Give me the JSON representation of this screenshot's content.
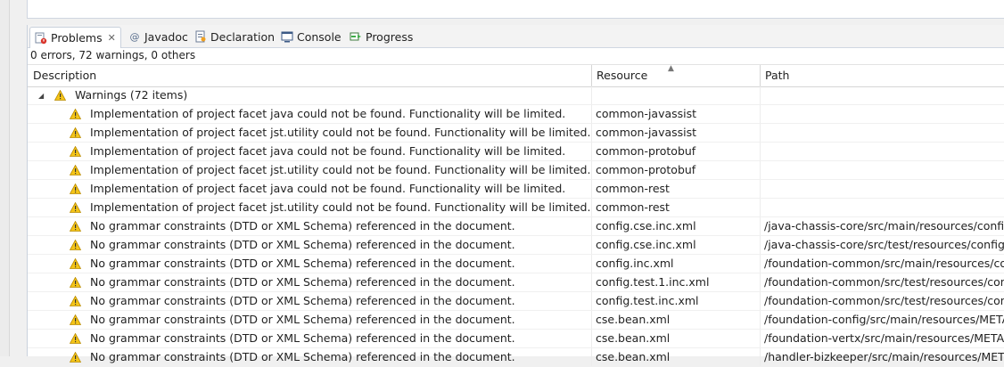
{
  "tabs": [
    {
      "label": "Problems",
      "icon": "problems-icon",
      "active": true,
      "close": "✕"
    },
    {
      "label": "Javadoc",
      "icon": "at-icon"
    },
    {
      "label": "Declaration",
      "icon": "declaration-icon"
    },
    {
      "label": "Console",
      "icon": "console-icon"
    },
    {
      "label": "Progress",
      "icon": "progress-icon"
    }
  ],
  "summary": "0 errors, 72 warnings, 0 others",
  "columns": {
    "description": "Description",
    "resource": "Resource",
    "path": "Path"
  },
  "group": {
    "label": "Warnings (72 items)",
    "expanded": true
  },
  "rows": [
    {
      "description": "Implementation of project facet java could not be found. Functionality will be limited.",
      "resource": "common-javassist",
      "path": ""
    },
    {
      "description": "Implementation of project facet jst.utility could not be found. Functionality will be limited.",
      "resource": "common-javassist",
      "path": ""
    },
    {
      "description": "Implementation of project facet java could not be found. Functionality will be limited.",
      "resource": "common-protobuf",
      "path": ""
    },
    {
      "description": "Implementation of project facet jst.utility could not be found. Functionality will be limited.",
      "resource": "common-protobuf",
      "path": ""
    },
    {
      "description": "Implementation of project facet java could not be found. Functionality will be limited.",
      "resource": "common-rest",
      "path": ""
    },
    {
      "description": "Implementation of project facet jst.utility could not be found. Functionality will be limited.",
      "resource": "common-rest",
      "path": ""
    },
    {
      "description": "No grammar constraints (DTD or XML Schema) referenced in the document.",
      "resource": "config.cse.inc.xml",
      "path": "/java-chassis-core/src/main/resources/config"
    },
    {
      "description": "No grammar constraints (DTD or XML Schema) referenced in the document.",
      "resource": "config.cse.inc.xml",
      "path": "/java-chassis-core/src/test/resources/config"
    },
    {
      "description": "No grammar constraints (DTD or XML Schema) referenced in the document.",
      "resource": "config.inc.xml",
      "path": "/foundation-common/src/main/resources/config"
    },
    {
      "description": "No grammar constraints (DTD or XML Schema) referenced in the document.",
      "resource": "config.test.1.inc.xml",
      "path": "/foundation-common/src/test/resources/config"
    },
    {
      "description": "No grammar constraints (DTD or XML Schema) referenced in the document.",
      "resource": "config.test.inc.xml",
      "path": "/foundation-common/src/test/resources/config"
    },
    {
      "description": "No grammar constraints (DTD or XML Schema) referenced in the document.",
      "resource": "cse.bean.xml",
      "path": "/foundation-config/src/main/resources/META-INF"
    },
    {
      "description": "No grammar constraints (DTD or XML Schema) referenced in the document.",
      "resource": "cse.bean.xml",
      "path": "/foundation-vertx/src/main/resources/META-INF"
    },
    {
      "description": "No grammar constraints (DTD or XML Schema) referenced in the document.",
      "resource": "cse.bean.xml",
      "path": "/handler-bizkeeper/src/main/resources/META-INF"
    }
  ],
  "colors": {
    "warning": "#f5c518",
    "tab_border": "#c9d1dc"
  }
}
